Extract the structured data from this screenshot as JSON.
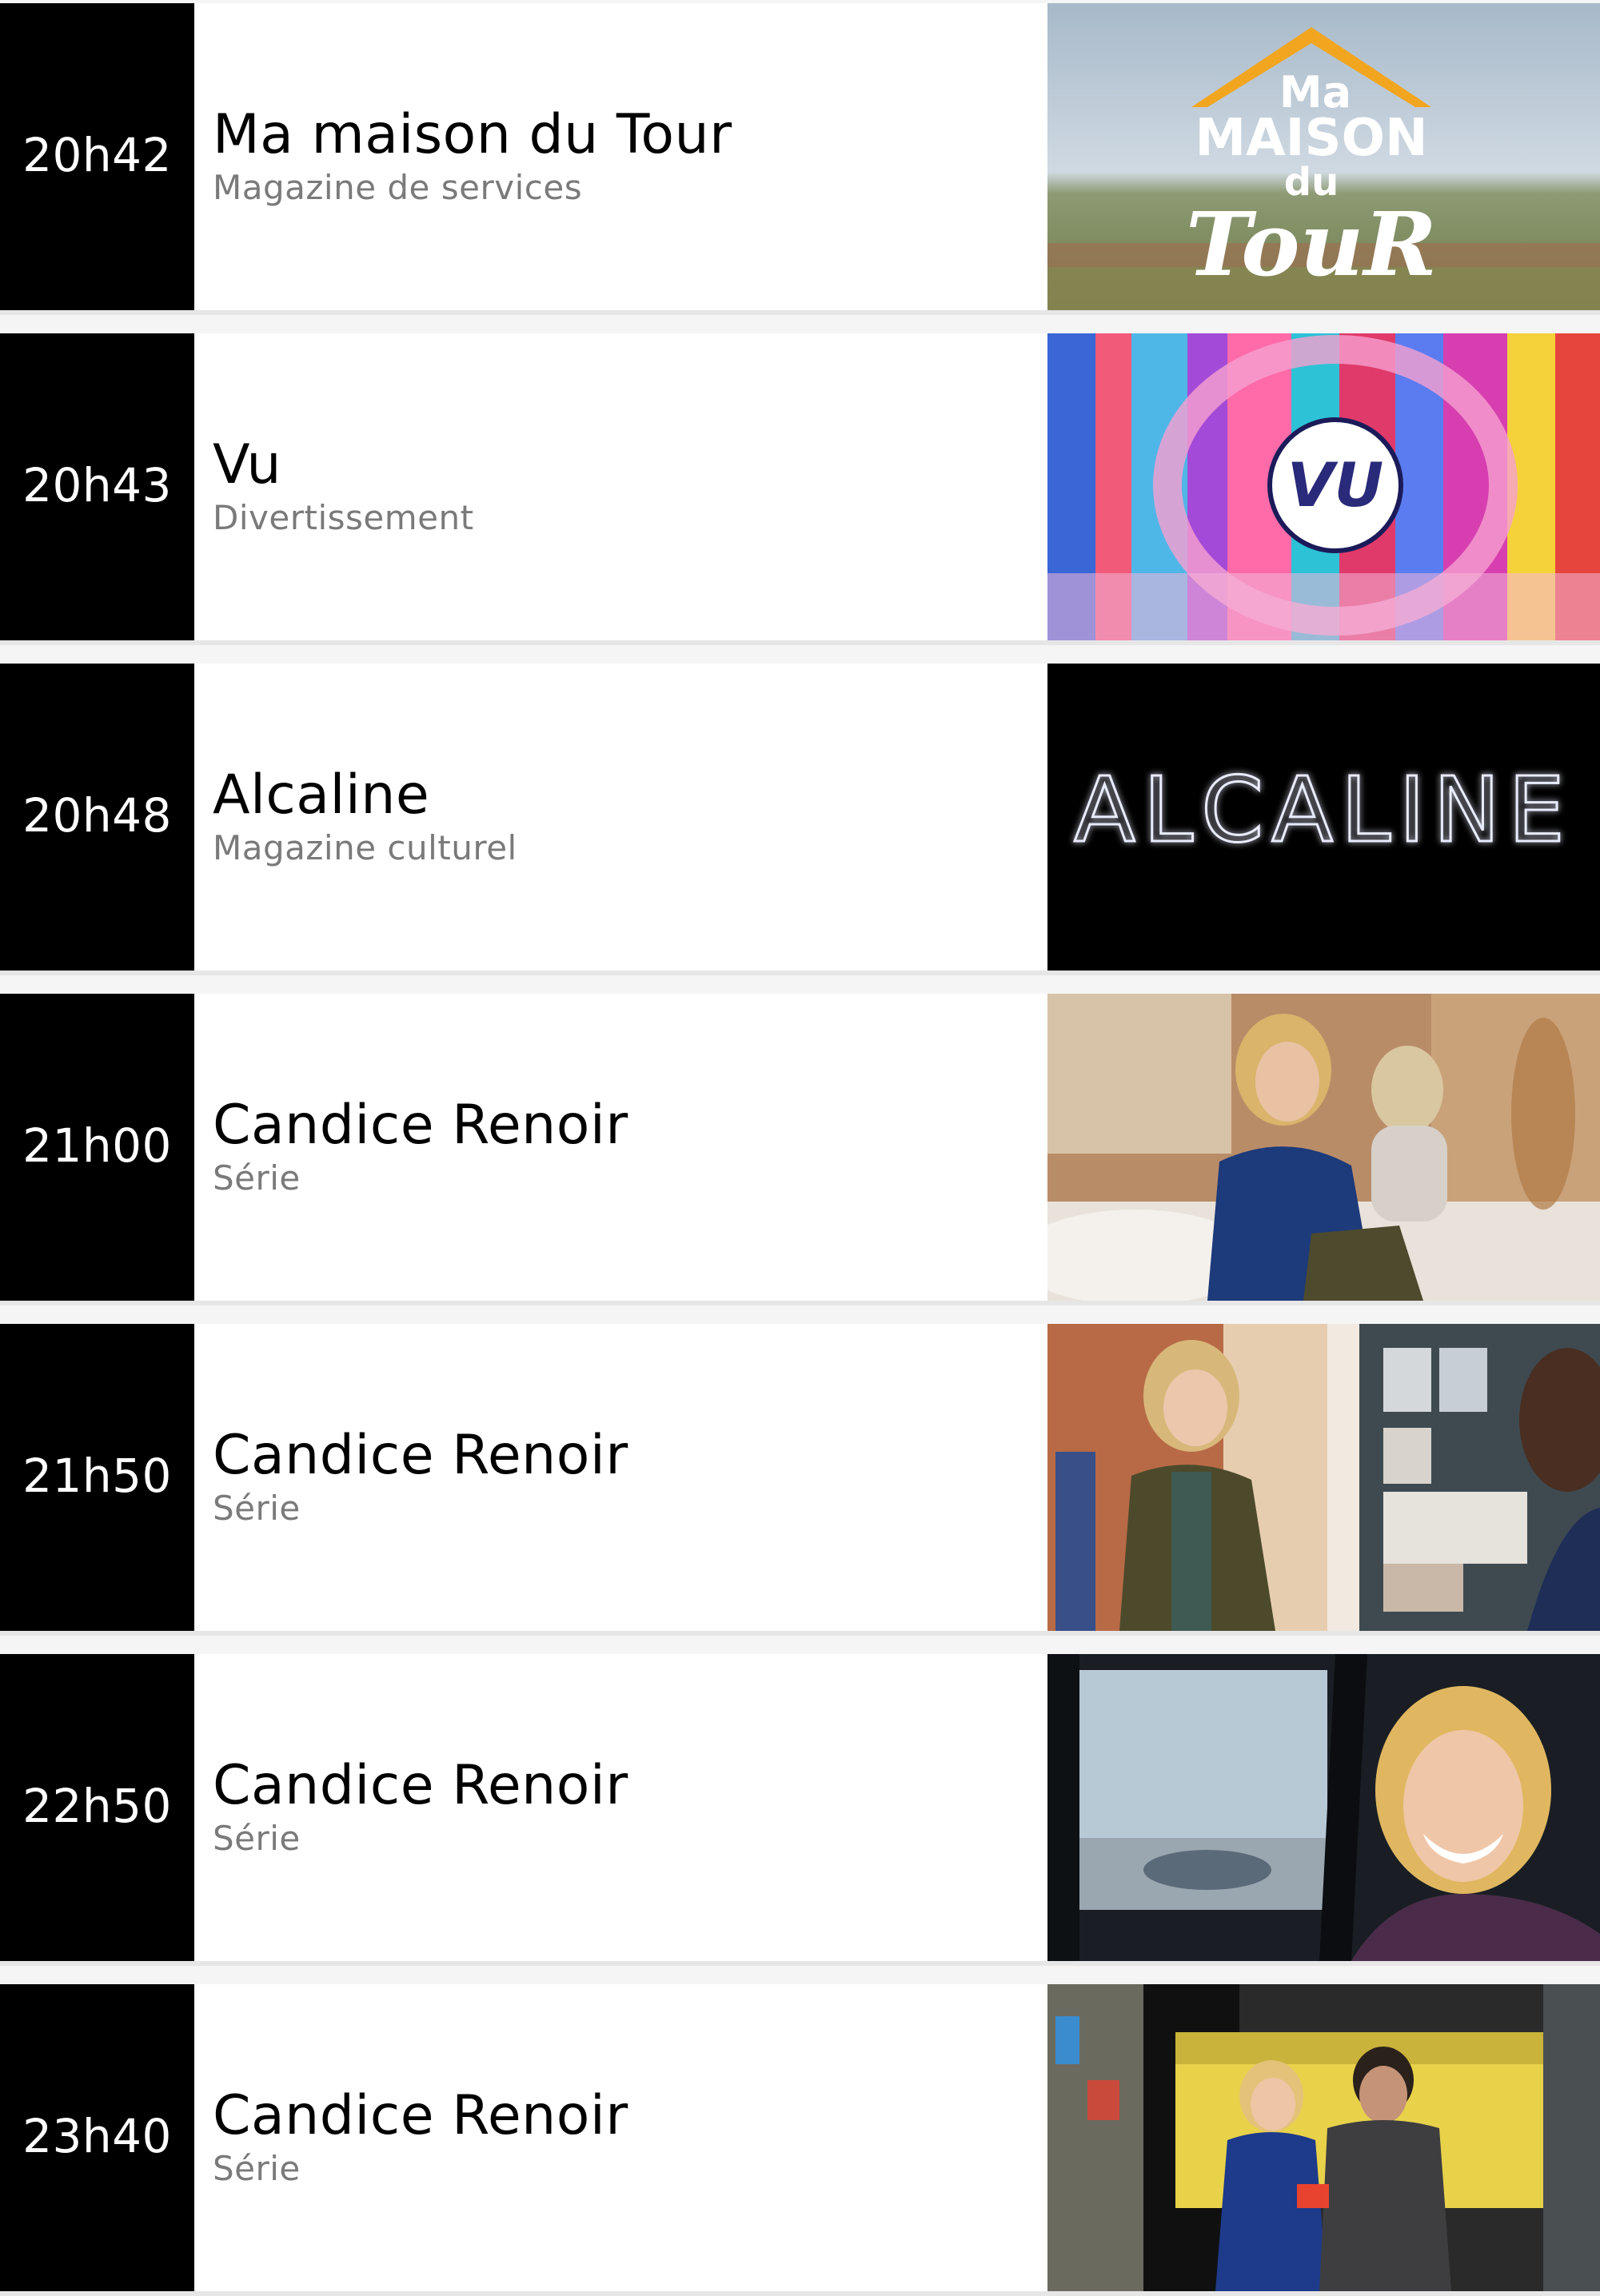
{
  "schedule": [
    {
      "time": "20h42",
      "title": "Ma maison du Tour",
      "genre": "Magazine de services",
      "thumbnail": {
        "lines": [
          "Ma",
          "MAISON",
          "du",
          "TouR"
        ]
      }
    },
    {
      "time": "20h43",
      "title": "Vu",
      "genre": "Divertissement",
      "thumbnail": {
        "logo": "VU"
      }
    },
    {
      "time": "20h48",
      "title": "Alcaline",
      "genre": "Magazine culturel",
      "thumbnail": {
        "logo": "ALCALINE"
      }
    },
    {
      "time": "21h00",
      "title": "Candice Renoir",
      "genre": "Série",
      "thumbnail": {}
    },
    {
      "time": "21h50",
      "title": "Candice Renoir",
      "genre": "Série",
      "thumbnail": {}
    },
    {
      "time": "22h50",
      "title": "Candice Renoir",
      "genre": "Série",
      "thumbnail": {}
    },
    {
      "time": "23h40",
      "title": "Candice Renoir",
      "genre": "Série",
      "thumbnail": {}
    }
  ]
}
